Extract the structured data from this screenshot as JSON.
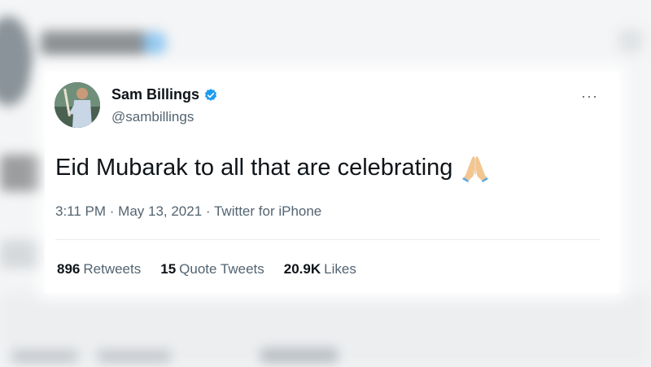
{
  "tweet": {
    "display_name": "Sam Billings",
    "handle": "@sambillings",
    "text": "Eid Mubarak to all that are celebrating",
    "timestamp": "3:11 PM · May 13, 2021",
    "separator": " · ",
    "source": "Twitter for iPhone",
    "verified": true,
    "emoji": "folded-hands",
    "more_label": "···",
    "stats": [
      {
        "count": "896",
        "label": "Retweets"
      },
      {
        "count": "15",
        "label": "Quote Tweets"
      },
      {
        "count": "20.9K",
        "label": "Likes"
      }
    ]
  },
  "colors": {
    "accent": "#1d9bf0",
    "text": "#0f1419",
    "secondary": "#536471"
  }
}
